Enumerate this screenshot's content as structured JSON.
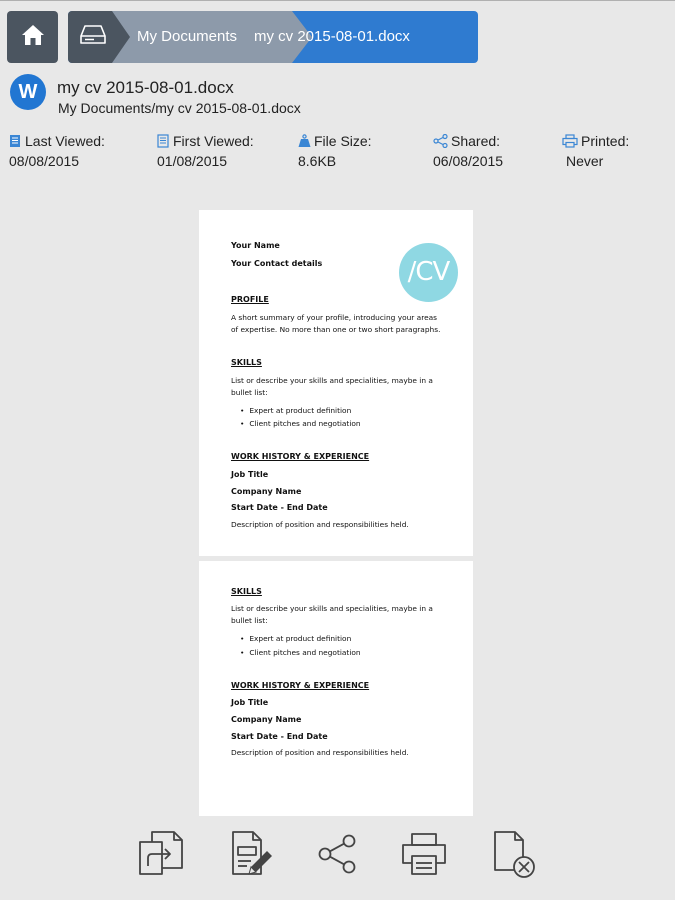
{
  "nav": {
    "home_icon": "home-icon",
    "drive_icon": "drive-icon",
    "folder_label": "My Documents",
    "file_label": "my cv 2015-08-01.docx"
  },
  "file": {
    "app_letter": "W",
    "name": "my cv 2015-08-01.docx",
    "path": "My Documents/my cv 2015-08-01.docx"
  },
  "meta": {
    "last_viewed_label": "Last Viewed:",
    "last_viewed_value": "08/08/2015",
    "first_viewed_label": "First Viewed:",
    "first_viewed_value": "01/08/2015",
    "file_size_label": "File Size:",
    "file_size_value": "8.6KB",
    "shared_label": "Shared:",
    "shared_value": "06/08/2015",
    "printed_label": "Printed:",
    "printed_value": "Never"
  },
  "preview": {
    "page1": {
      "name": "Your Name",
      "contact": "Your Contact details",
      "logo_text": "/CV",
      "profile_heading": "PROFILE",
      "profile_text": "A short summary of your profile, introducing your areas of expertise. No more than one or two short paragraphs.",
      "skills_heading": "SKILLS",
      "skills_text": "List or describe your skills and specialities, maybe in a bullet list:",
      "bullets": [
        "Expert at product definition",
        "Client pitches and negotiation"
      ],
      "work_heading": "WORK HISTORY & EXPERIENCE",
      "job_title": "Job Title",
      "company": "Company Name",
      "dates": "Start Date - End Date",
      "description": "Description of position and responsibilities held."
    },
    "page2": {
      "skills_heading": "SKILLS",
      "skills_text": "List or describe your skills and specialities, maybe in a bullet list:",
      "bullets": [
        "Expert at product definition",
        "Client pitches and negotiation"
      ],
      "work_heading": "WORK HISTORY & EXPERIENCE",
      "job_title": "Job Title",
      "company": "Company Name",
      "dates": "Start Date - End Date",
      "description": "Description of position and responsibilities held."
    }
  },
  "toolbar": {
    "icons": [
      "open-with-icon",
      "edit-icon",
      "share-icon",
      "print-icon",
      "delete-icon"
    ]
  },
  "colors": {
    "accent": "#2f7bd0",
    "dark": "#4b5560",
    "crumb_mid": "#8d9aaa",
    "icon_blue": "#3a86d4",
    "logo": "#8fd8e3"
  }
}
